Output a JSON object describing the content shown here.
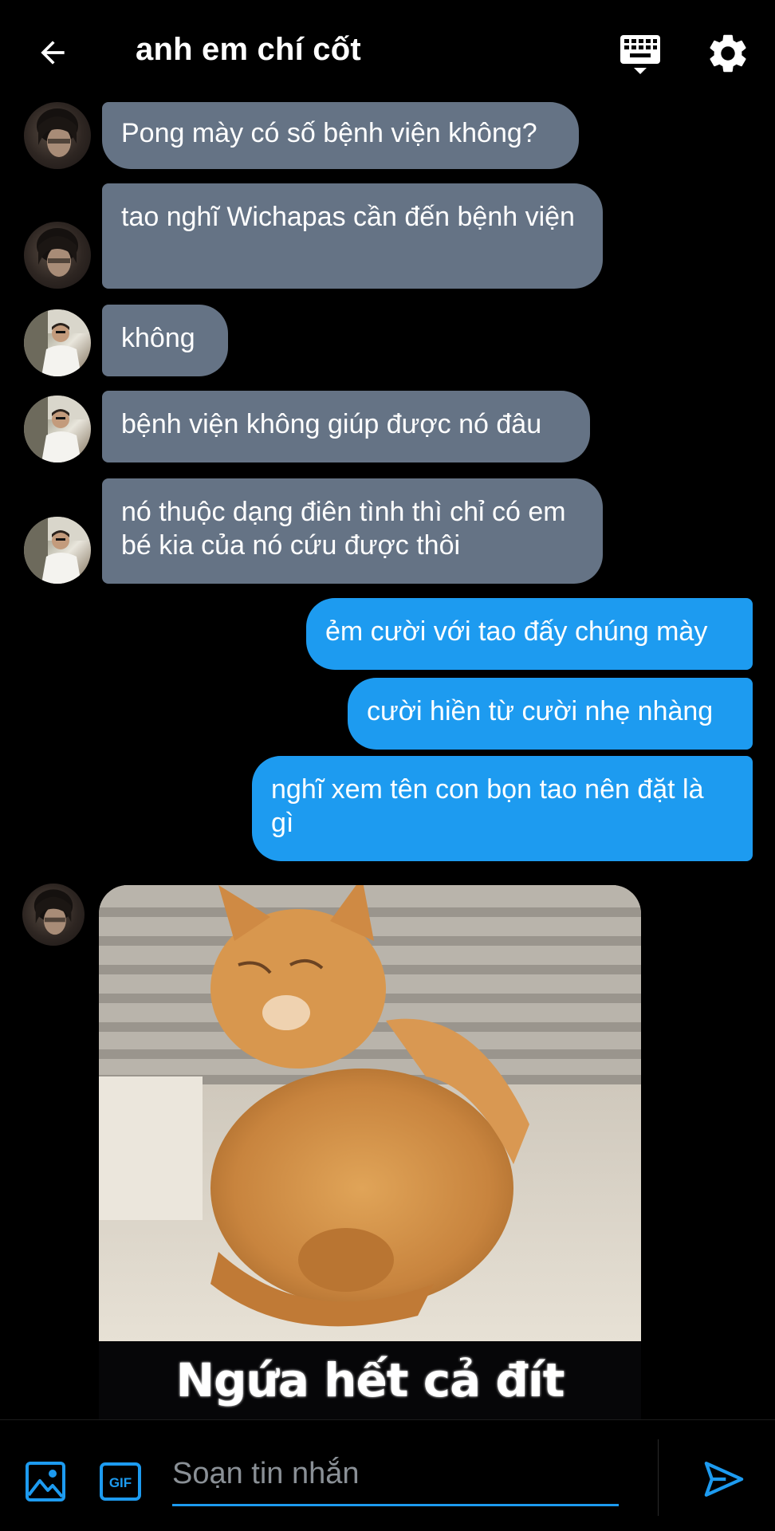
{
  "header": {
    "back_icon": "arrow-left-icon",
    "title": "anh em chí cốt",
    "keyboard_icon": "keyboard-icon",
    "settings_icon": "gear-icon"
  },
  "messages": [
    {
      "direction": "incoming",
      "sender_avatar": "avatar-dark-hair",
      "text": "Pong mày có số bệnh viện không?"
    },
    {
      "direction": "incoming",
      "sender_avatar": "avatar-dark-hair",
      "text": "tao nghĩ Wichapas cần đến bệnh viện"
    },
    {
      "direction": "incoming",
      "sender_avatar": "avatar-white-shirt",
      "text": "không"
    },
    {
      "direction": "incoming",
      "sender_avatar": "avatar-white-shirt",
      "text": "bệnh viện không giúp được nó đâu"
    },
    {
      "direction": "incoming",
      "sender_avatar": "avatar-white-shirt",
      "text": "nó thuộc dạng điên tình thì chỉ có em bé kia của nó cứu được thôi"
    },
    {
      "direction": "outgoing",
      "text": "ẻm cười với tao đấy chúng mày"
    },
    {
      "direction": "outgoing",
      "text": "cười hiền từ cười nhẹ nhàng"
    },
    {
      "direction": "outgoing",
      "text": "nghĩ xem tên con bọn tao nên đặt là gì"
    }
  ],
  "image_message": {
    "sender_avatar": "avatar-dark-hair",
    "caption": "Ngứa hết cả đít"
  },
  "composer": {
    "image_icon": "image-icon",
    "gif_label": "GIF",
    "placeholder": "Soạn tin nhắn",
    "value": "",
    "send_icon": "send-icon"
  },
  "colors": {
    "background": "#000000",
    "incoming_bubble": "#657385",
    "outgoing_bubble": "#1d9bf0",
    "accent": "#1d9bf0"
  }
}
